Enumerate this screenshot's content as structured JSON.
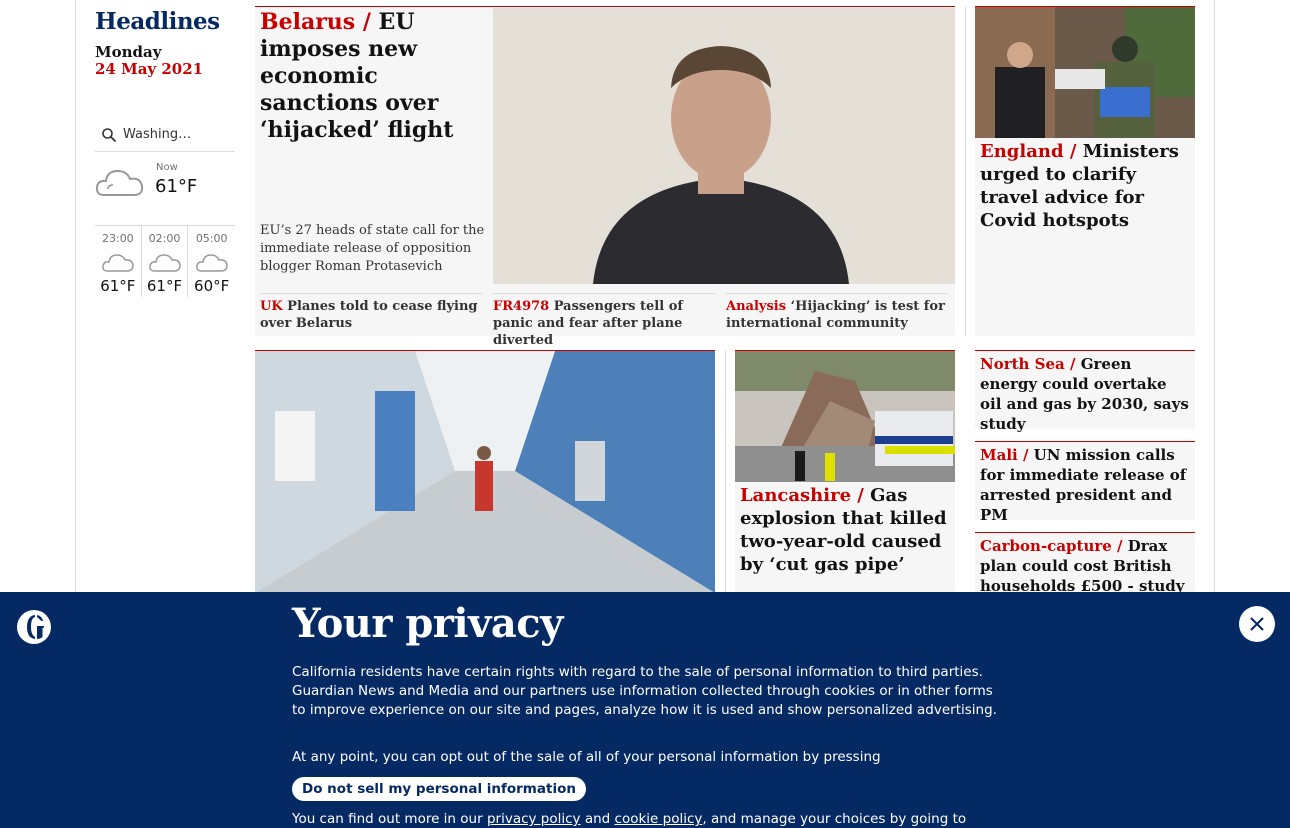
{
  "sidebar": {
    "title": "Headlines",
    "day": "Monday",
    "date": "24 May 2021",
    "weather": {
      "location": "Washing…",
      "now_label": "Now",
      "now_temp": "61°F",
      "hours": [
        {
          "time": "23:00",
          "temp": "61°F"
        },
        {
          "time": "02:00",
          "temp": "61°F"
        },
        {
          "time": "05:00",
          "temp": "60°F"
        }
      ]
    }
  },
  "feature": {
    "kicker": "Belarus /",
    "headline": "EU imposes new economic sanctions over ‘hijacked’ flight",
    "standfirst": "EU’s 27 heads of state call for the immediate release of opposition blogger Roman Protasevich",
    "sublinks": [
      {
        "kicker": "UK",
        "text": "Planes told to cease flying over Belarus"
      },
      {
        "kicker": "FR4978",
        "text": "Passengers tell of panic and fear after plane diverted"
      },
      {
        "kicker": "Analysis",
        "text": "‘Hijacking’ is test for international community"
      }
    ]
  },
  "right_card": {
    "kicker": "England /",
    "headline": "Ministers urged to clarify travel advice for Covid hotspots"
  },
  "lancashire": {
    "kicker": "Lancashire /",
    "headline": "Gas explosion that killed two-year-old caused by ‘cut gas pipe’"
  },
  "small_stories": [
    {
      "kicker": "North Sea  /",
      "headline": "Green energy could overtake oil and gas by 2030, says study"
    },
    {
      "kicker": "Mali /",
      "headline": "UN mission calls for immediate release of arrested president and PM"
    },
    {
      "kicker": "Carbon-capture /",
      "headline": "Drax plan could cost British households £500 - study"
    }
  ],
  "privacy": {
    "title": "Your privacy",
    "body": "California residents have certain rights with regard to the sale of personal information to third parties. Guardian News and Media and our partners use information collected through cookies or in other forms to improve experience on our site and pages, analyze how it is used and show personalized advertising.",
    "body2": "At any point, you can opt out of the sale of all of your personal information by pressing",
    "button": "Do not sell my personal information",
    "footer_prefix": "You can find out more in our ",
    "privacy_link": "privacy policy",
    "and": " and ",
    "cookie_link": "cookie policy",
    "footer_suffix": ", and manage your choices by going to"
  },
  "colors": {
    "brand_blue": "#052962",
    "kicker_red": "#c70000",
    "card_bg": "#f6f6f6"
  }
}
